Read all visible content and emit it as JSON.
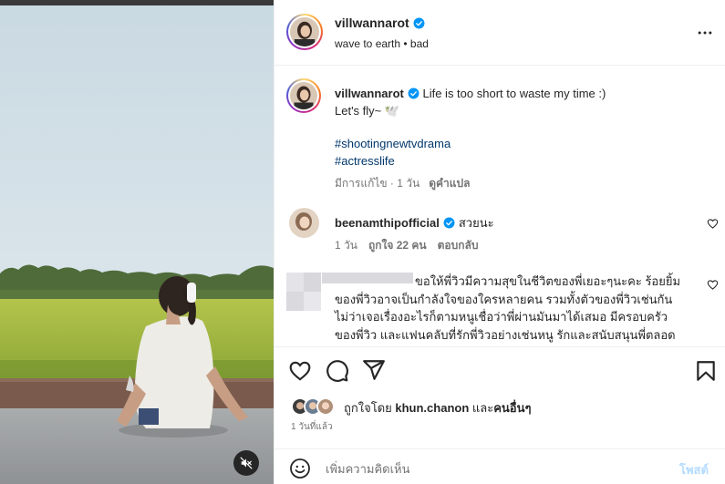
{
  "post": {
    "username": "villwannarot",
    "header_subtitle": "wave to earth • bad",
    "caption_text": "Life is too short to waste my time :)",
    "caption_line2": "Let's fly~ 🕊️",
    "hashtags": [
      "#shootingnewtvdrama",
      "#actresslife"
    ],
    "caption_meta": {
      "edited": "มีการแก้ไข · 1 วัน",
      "translate": "ดูคำแปล"
    }
  },
  "comments": [
    {
      "username": "beenamthipofficial",
      "text": "สวยนะ",
      "time": "1 วัน",
      "likes": "ถูกใจ 22 คน",
      "reply": "ตอบกลับ"
    },
    {
      "lines": [
        "ขอให้พี่วิวมีความสุขในชีวิตของพี่เยอะๆนะคะ ร้อยยิ้ม",
        "ของพี่วิวอาจเป็นกำลังใจของใครหลายคน รวมทั้งตัวของพี่วิวเช่นกัน",
        "ไม่ว่าเจอเรื่องอะไรก็ตามหนูเชื่อว่าพี่ผ่านมันมาได้เสมอ มีครอบครัว",
        "ของพี่วิว และแฟนคลับที่รักพี่วิวอย่างเช่นหนู รักและสนับสนุนพี่ตลอด"
      ]
    }
  ],
  "likes": {
    "prefix": "ถูกใจโดย ",
    "user": "khun.chanon",
    "middle": " และ",
    "others": "คนอื่นๆ"
  },
  "timestamp": "1 วันที่แล้ว",
  "add_comment": {
    "placeholder": "เพิ่มความคิดเห็น",
    "post_label": "โพสต์"
  },
  "colors": {
    "verified": "#0095f6",
    "link": "#00376b",
    "muted": "#737373",
    "post_disabled": "#b3dbff"
  },
  "icons": [
    "verified-badge-icon",
    "more-options-icon",
    "heart-icon",
    "comment-icon",
    "share-icon",
    "bookmark-icon",
    "emoji-icon",
    "speaker-muted-icon"
  ]
}
